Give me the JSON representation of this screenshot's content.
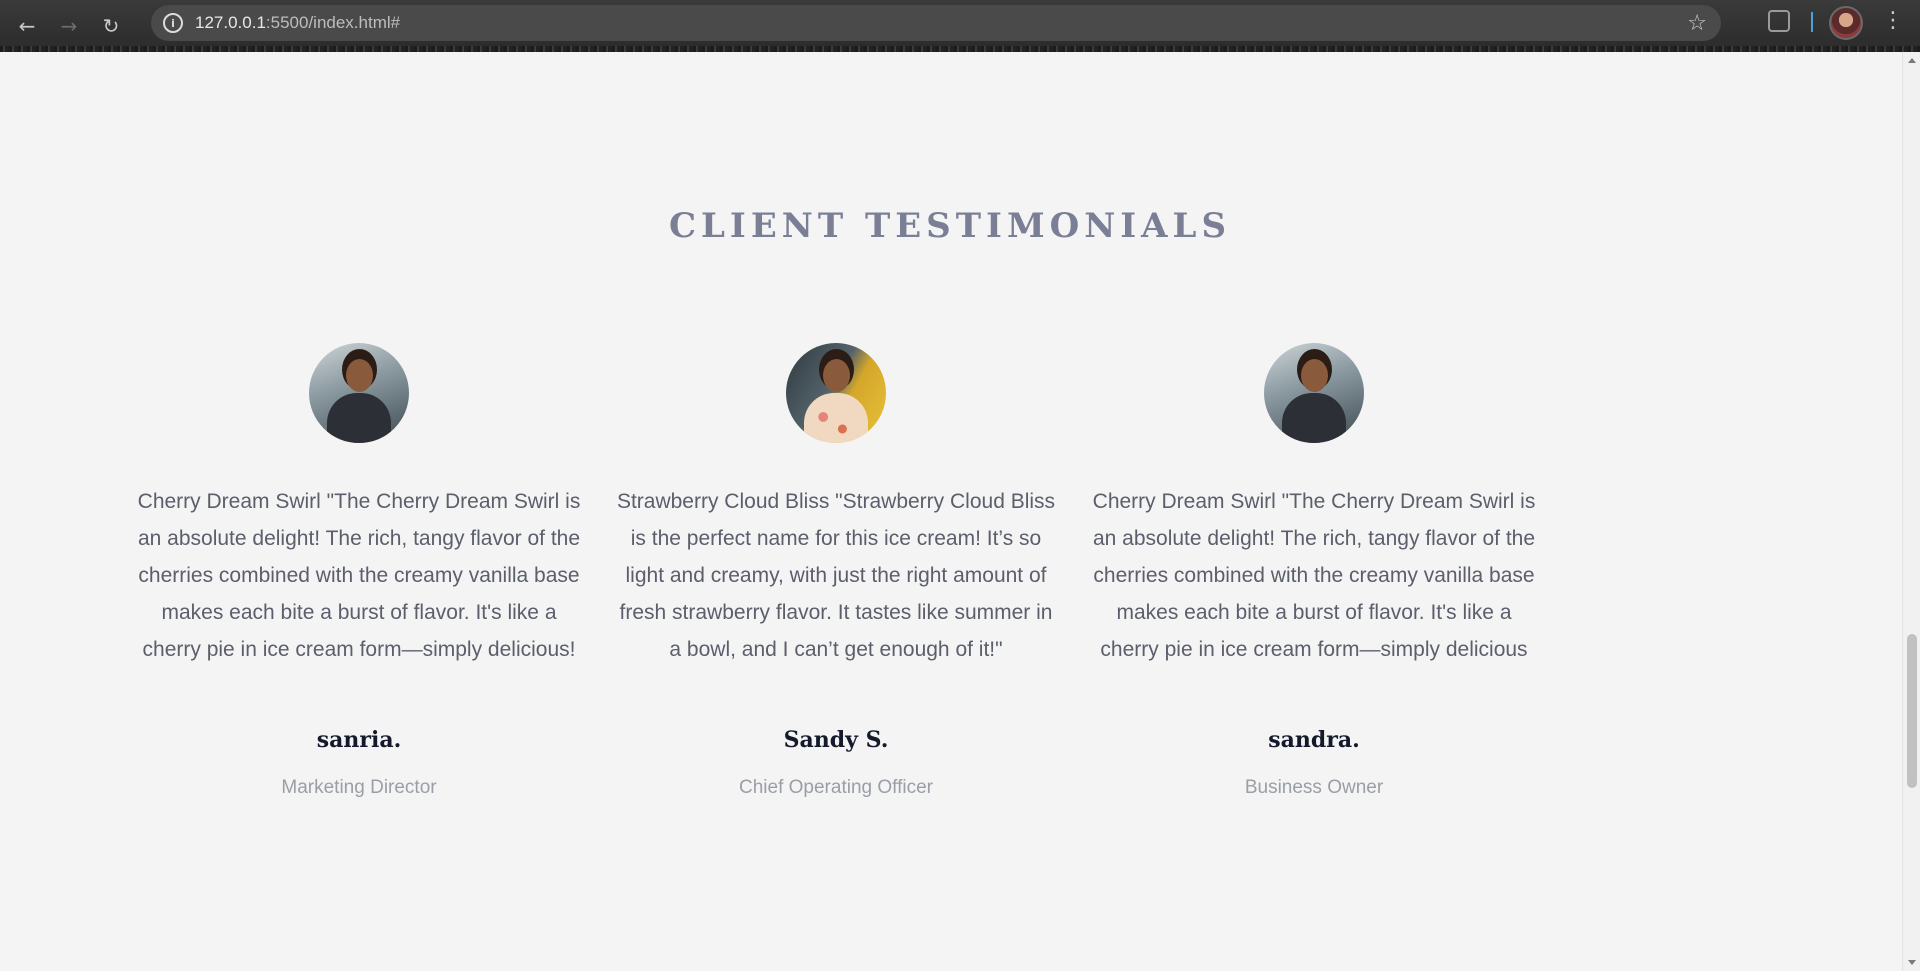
{
  "browser": {
    "url_host": "127.0.0.1",
    "url_path": ":5500/index.html#"
  },
  "section": {
    "title": "CLIENT TESTIMONIALS"
  },
  "testimonials": [
    {
      "quote": "Cherry Dream Swirl \"The Cherry Dream Swirl is an absolute delight! The rich, tangy flavor of the cherries combined with the creamy vanilla base makes each bite a burst of flavor. It's like a cherry pie in ice cream form—simply delicious!",
      "name": "sanria.",
      "role": "Marketing Director"
    },
    {
      "quote": "Strawberry Cloud Bliss \"Strawberry Cloud Bliss is the perfect name for this ice cream! It’s so light and creamy, with just the right amount of fresh strawberry flavor. It tastes like summer in a bowl, and I can’t get enough of it!\"",
      "name": "Sandy S.",
      "role": "Chief Operating Officer"
    },
    {
      "quote": "Cherry Dream Swirl \"The Cherry Dream Swirl is an absolute delight! The rich, tangy flavor of the cherries combined with the creamy vanilla base makes each bite a burst of flavor. It's like a cherry pie in ice cream form—simply delicious",
      "name": "sandra.",
      "role": "Business Owner"
    }
  ]
}
